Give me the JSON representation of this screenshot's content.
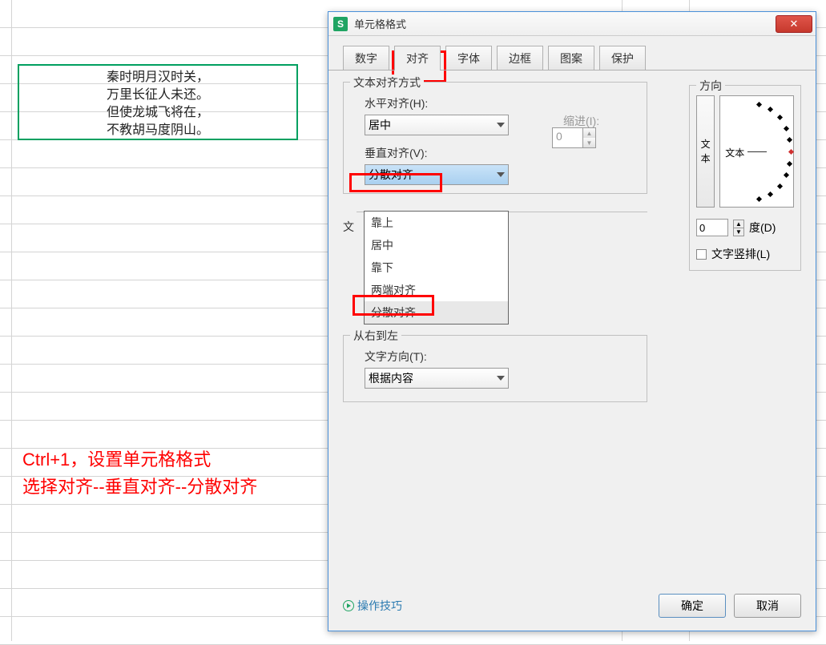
{
  "cell_poem": {
    "l1": "秦时明月汉时关，",
    "l2": "万里长征人未还。",
    "l3": "但使龙城飞将在，",
    "l4": "不教胡马度阴山。"
  },
  "instruction": {
    "l1": "Ctrl+1，设置单元格格式",
    "l2": "选择对齐--垂直对齐--分散对齐"
  },
  "dialog": {
    "title": "单元格格式",
    "tabs": {
      "number": "数字",
      "align": "对齐",
      "font": "字体",
      "border": "边框",
      "pattern": "图案",
      "protect": "保护"
    },
    "align_group": "文本对齐方式",
    "horiz_label": "水平对齐(H):",
    "horiz_value": "居中",
    "indent_label": "缩进(I):",
    "indent_value": "0",
    "vert_label": "垂直对齐(V):",
    "vert_value": "分散对齐",
    "vert_options": {
      "o1": "靠上",
      "o2": "居中",
      "o3": "靠下",
      "o4": "两端对齐",
      "o5": "分散对齐"
    },
    "rtl_group": "从右到左",
    "text_dir_label": "文字方向(T):",
    "text_dir_value": "根据内容",
    "direction_group": "方向",
    "orient_vert": "文本",
    "orient_text": "文本",
    "degree_value": "0",
    "degree_label": "度(D)",
    "vertical_text": "文字竖排(L)",
    "tips": "操作技巧",
    "ok": "确定",
    "cancel": "取消"
  }
}
